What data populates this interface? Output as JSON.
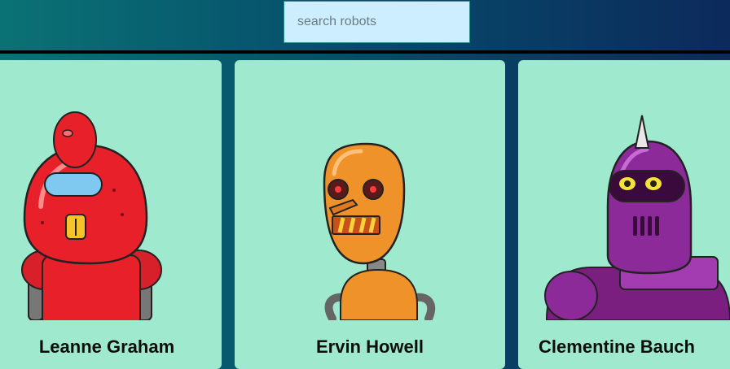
{
  "search": {
    "placeholder": "search robots"
  },
  "robots": [
    {
      "name": "Leanne Graham",
      "color": "#e8202a"
    },
    {
      "name": "Ervin Howell",
      "color": "#f0922a"
    },
    {
      "name": "Clementine Bauch",
      "color": "#8c2a9a"
    }
  ],
  "colors": {
    "card_bg": "#9feace",
    "search_bg": "#cdeeff"
  }
}
